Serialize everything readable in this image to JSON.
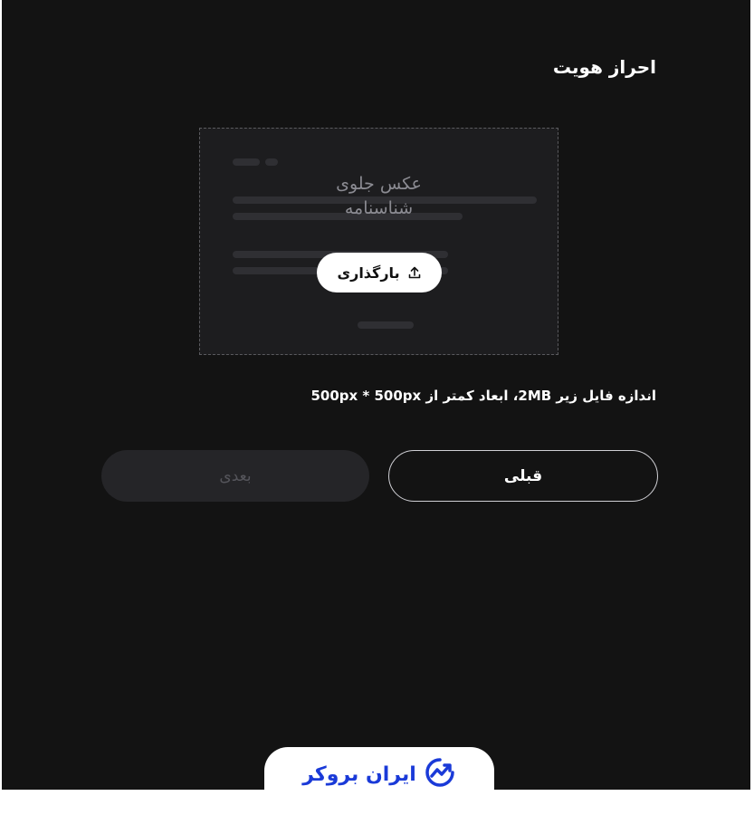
{
  "page": {
    "title": "احراز هویت"
  },
  "upload": {
    "card_label_line1": "عکس جلوی",
    "card_label_line2": "شناسنامه",
    "button_label": "بارگذاری",
    "button_icon": "upload-icon"
  },
  "note": {
    "text": "اندازه فایل زیر 2MB، ابعاد کمتر از 500px * 500px"
  },
  "actions": {
    "prev_label": "قبلی",
    "next_label": "بعدی"
  },
  "brand": {
    "name": "ایران بروکر",
    "color": "#1a3ad8"
  },
  "colors": {
    "background": "#131313",
    "card": "#1d1d1f",
    "disabled_button": "#252528"
  }
}
